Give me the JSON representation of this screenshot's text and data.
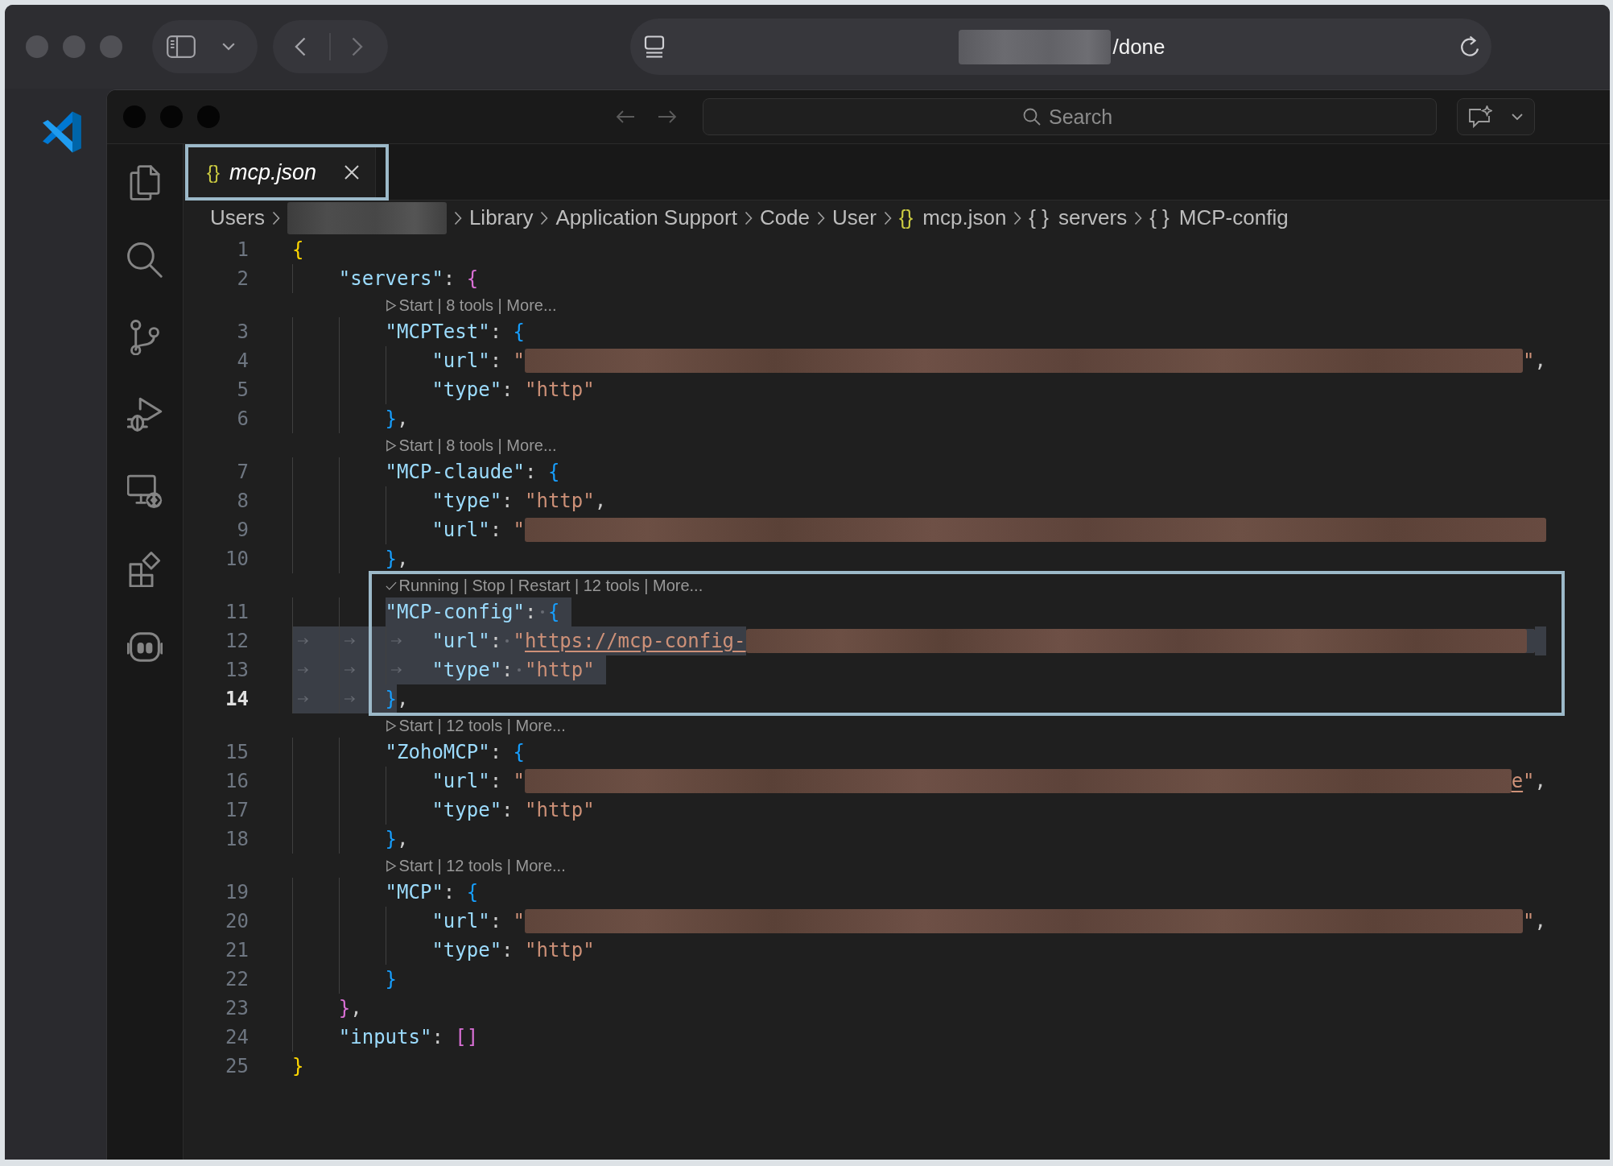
{
  "browser": {
    "address": {
      "text": "/done"
    }
  },
  "title_bar": {
    "search": {
      "placeholder": "Search"
    }
  },
  "tabs": [
    {
      "icon": "{}",
      "label": "mcp.json",
      "selected": true,
      "preview": true
    }
  ],
  "breadcrumbs": [
    {
      "kind": "text",
      "label": "Users"
    },
    {
      "kind": "redacted"
    },
    {
      "kind": "text",
      "label": "Library"
    },
    {
      "kind": "text",
      "label": "Application Support"
    },
    {
      "kind": "text",
      "label": "Code"
    },
    {
      "kind": "text",
      "label": "User"
    },
    {
      "kind": "file",
      "icon": "{}",
      "label": "mcp.json"
    },
    {
      "kind": "symbol",
      "icon": "{ }",
      "label": "servers"
    },
    {
      "kind": "symbol",
      "icon": "{ }",
      "label": "MCP-config"
    }
  ],
  "editor": {
    "lines": [
      {
        "number": "1",
        "current": false,
        "tokens": [
          {
            "kind": "bracket",
            "color": "#ffd700",
            "text": "{",
            "selected": false
          }
        ]
      },
      {
        "number": "2",
        "current": false,
        "indent_guides": [
          {
            "selected": false
          }
        ],
        "tokens": [
          {
            "kind": "key",
            "text": "\"servers\"",
            "selected": false
          },
          {
            "kind": "punct",
            "text": ": ",
            "selected": false
          },
          {
            "kind": "bracket",
            "color": "#da70d6",
            "text": "{",
            "selected": false
          }
        ]
      },
      {
        "number": "3",
        "current": false,
        "lens": {
          "running": false,
          "text": "Start | 8 tools | More..."
        },
        "indent_guides": [
          {
            "selected": false
          },
          {
            "selected": false
          }
        ],
        "tokens": [
          {
            "kind": "key",
            "text": "\"MCPTest\"",
            "selected": false
          },
          {
            "kind": "punct",
            "text": ": ",
            "selected": false
          },
          {
            "kind": "bracket",
            "color": "#179fff",
            "text": "{",
            "selected": false
          }
        ]
      },
      {
        "number": "4",
        "current": false,
        "indent_guides": [
          {
            "selected": false
          },
          {
            "selected": false
          },
          {
            "selected": false
          }
        ],
        "tokens": [
          {
            "kind": "key",
            "text": "\"url\"",
            "selected": false
          },
          {
            "kind": "punct",
            "text": ": ",
            "selected": false
          },
          {
            "kind": "string",
            "text": "\"",
            "selected": false
          },
          {
            "kind": "redacted",
            "selected": false
          },
          {
            "kind": "string",
            "text": "\"",
            "selected": false
          },
          {
            "kind": "punct",
            "text": ",",
            "selected": false
          }
        ]
      },
      {
        "number": "5",
        "current": false,
        "indent_guides": [
          {
            "selected": false
          },
          {
            "selected": false
          },
          {
            "selected": false
          }
        ],
        "tokens": [
          {
            "kind": "key",
            "text": "\"type\"",
            "selected": false
          },
          {
            "kind": "punct",
            "text": ": ",
            "selected": false
          },
          {
            "kind": "string",
            "text": "\"http\"",
            "selected": false
          }
        ]
      },
      {
        "number": "6",
        "current": false,
        "indent_guides": [
          {
            "selected": false
          },
          {
            "selected": false
          }
        ],
        "tokens": [
          {
            "kind": "bracket",
            "color": "#179fff",
            "text": "}",
            "selected": false
          },
          {
            "kind": "punct",
            "text": ",",
            "selected": false
          }
        ]
      },
      {
        "number": "7",
        "current": false,
        "lens": {
          "running": false,
          "text": "Start | 8 tools | More..."
        },
        "indent_guides": [
          {
            "selected": false
          },
          {
            "selected": false
          }
        ],
        "tokens": [
          {
            "kind": "key",
            "text": "\"MCP-claude\"",
            "selected": false
          },
          {
            "kind": "punct",
            "text": ": ",
            "selected": false
          },
          {
            "kind": "bracket",
            "color": "#179fff",
            "text": "{",
            "selected": false
          }
        ]
      },
      {
        "number": "8",
        "current": false,
        "indent_guides": [
          {
            "selected": false
          },
          {
            "selected": false
          },
          {
            "selected": false
          }
        ],
        "tokens": [
          {
            "kind": "key",
            "text": "\"type\"",
            "selected": false
          },
          {
            "kind": "punct",
            "text": ": ",
            "selected": false
          },
          {
            "kind": "string",
            "text": "\"http\"",
            "selected": false
          },
          {
            "kind": "punct",
            "text": ",",
            "selected": false
          }
        ]
      },
      {
        "number": "9",
        "current": false,
        "indent_guides": [
          {
            "selected": false
          },
          {
            "selected": false
          },
          {
            "selected": false
          }
        ],
        "tokens": [
          {
            "kind": "key",
            "text": "\"url\"",
            "selected": false
          },
          {
            "kind": "punct",
            "text": ": ",
            "selected": false
          },
          {
            "kind": "string",
            "text": "\"",
            "selected": false
          },
          {
            "kind": "redacted",
            "selected": false
          }
        ]
      },
      {
        "number": "10",
        "current": false,
        "indent_guides": [
          {
            "selected": false
          },
          {
            "selected": false
          }
        ],
        "tokens": [
          {
            "kind": "bracket",
            "color": "#179fff",
            "text": "}",
            "selected": false
          },
          {
            "kind": "punct",
            "text": ",",
            "selected": false
          }
        ]
      },
      {
        "number": "11",
        "current": false,
        "lens": {
          "running": true,
          "text": "Running | Stop | Restart | 12 tools | More..."
        },
        "indent_guides": [
          {
            "selected": false
          },
          {
            "selected": false
          }
        ],
        "tokens": [
          {
            "kind": "key",
            "text": "\"MCP-config\"",
            "selected": true
          },
          {
            "kind": "punct",
            "text": ": ",
            "selected": true
          },
          {
            "kind": "bracket",
            "color": "#179fff",
            "text": "{",
            "selected": true
          }
        ]
      },
      {
        "number": "12",
        "current": false,
        "indent_guides": [
          {
            "selected": true
          },
          {
            "selected": true
          },
          {
            "selected": true
          }
        ],
        "tokens": [
          {
            "kind": "key",
            "text": "\"url\"",
            "selected": true
          },
          {
            "kind": "punct",
            "text": ": ",
            "selected": true
          },
          {
            "kind": "string",
            "text": "\"",
            "selected": true
          },
          {
            "kind": "link",
            "text": "https://mcp-config-",
            "selected": true
          },
          {
            "kind": "redacted",
            "selected": true
          }
        ]
      },
      {
        "number": "13",
        "current": false,
        "indent_guides": [
          {
            "selected": true
          },
          {
            "selected": true
          },
          {
            "selected": true
          }
        ],
        "tokens": [
          {
            "kind": "key",
            "text": "\"type\"",
            "selected": true
          },
          {
            "kind": "punct",
            "text": ": ",
            "selected": true
          },
          {
            "kind": "string",
            "text": "\"http\"",
            "selected": true
          }
        ]
      },
      {
        "number": "14",
        "current": true,
        "indent_guides": [
          {
            "selected": true
          },
          {
            "selected": true
          }
        ],
        "tokens": [
          {
            "kind": "bracket",
            "color": "#179fff",
            "text": "}",
            "selected": true
          },
          {
            "kind": "punct",
            "text": ",",
            "selected": false
          }
        ]
      },
      {
        "number": "15",
        "current": false,
        "lens": {
          "running": false,
          "text": "Start | 12 tools | More..."
        },
        "indent_guides": [
          {
            "selected": false
          },
          {
            "selected": false
          }
        ],
        "tokens": [
          {
            "kind": "key",
            "text": "\"ZohoMCP\"",
            "selected": false
          },
          {
            "kind": "punct",
            "text": ": ",
            "selected": false
          },
          {
            "kind": "bracket",
            "color": "#179fff",
            "text": "{",
            "selected": false
          }
        ]
      },
      {
        "number": "16",
        "current": false,
        "indent_guides": [
          {
            "selected": false
          },
          {
            "selected": false
          },
          {
            "selected": false
          }
        ],
        "tokens": [
          {
            "kind": "key",
            "text": "\"url\"",
            "selected": false
          },
          {
            "kind": "punct",
            "text": ": ",
            "selected": false
          },
          {
            "kind": "string",
            "text": "\"",
            "selected": false
          },
          {
            "kind": "redacted",
            "selected": false
          },
          {
            "kind": "link",
            "text": "e",
            "selected": false
          },
          {
            "kind": "string",
            "text": "\"",
            "selected": false
          },
          {
            "kind": "punct",
            "text": ",",
            "selected": false
          }
        ]
      },
      {
        "number": "17",
        "current": false,
        "indent_guides": [
          {
            "selected": false
          },
          {
            "selected": false
          },
          {
            "selected": false
          }
        ],
        "tokens": [
          {
            "kind": "key",
            "text": "\"type\"",
            "selected": false
          },
          {
            "kind": "punct",
            "text": ": ",
            "selected": false
          },
          {
            "kind": "string",
            "text": "\"http\"",
            "selected": false
          }
        ]
      },
      {
        "number": "18",
        "current": false,
        "indent_guides": [
          {
            "selected": false
          },
          {
            "selected": false
          }
        ],
        "tokens": [
          {
            "kind": "bracket",
            "color": "#179fff",
            "text": "}",
            "selected": false
          },
          {
            "kind": "punct",
            "text": ",",
            "selected": false
          }
        ]
      },
      {
        "number": "19",
        "current": false,
        "lens": {
          "running": false,
          "text": "Start | 12 tools | More..."
        },
        "indent_guides": [
          {
            "selected": false
          },
          {
            "selected": false
          }
        ],
        "tokens": [
          {
            "kind": "key",
            "text": "\"MCP\"",
            "selected": false
          },
          {
            "kind": "punct",
            "text": ": ",
            "selected": false
          },
          {
            "kind": "bracket",
            "color": "#179fff",
            "text": "{",
            "selected": false
          }
        ]
      },
      {
        "number": "20",
        "current": false,
        "indent_guides": [
          {
            "selected": false
          },
          {
            "selected": false
          },
          {
            "selected": false
          }
        ],
        "tokens": [
          {
            "kind": "key",
            "text": "\"url\"",
            "selected": false
          },
          {
            "kind": "punct",
            "text": ": ",
            "selected": false
          },
          {
            "kind": "string",
            "text": "\"",
            "selected": false
          },
          {
            "kind": "redacted",
            "selected": false
          },
          {
            "kind": "string",
            "text": "\"",
            "selected": false
          },
          {
            "kind": "punct",
            "text": ",",
            "selected": false
          }
        ]
      },
      {
        "number": "21",
        "current": false,
        "indent_guides": [
          {
            "selected": false
          },
          {
            "selected": false
          },
          {
            "selected": false
          }
        ],
        "tokens": [
          {
            "kind": "key",
            "text": "\"type\"",
            "selected": false
          },
          {
            "kind": "punct",
            "text": ": ",
            "selected": false
          },
          {
            "kind": "string",
            "text": "\"http\"",
            "selected": false
          }
        ]
      },
      {
        "number": "22",
        "current": false,
        "indent_guides": [
          {
            "selected": false
          },
          {
            "selected": false
          }
        ],
        "tokens": [
          {
            "kind": "bracket",
            "color": "#179fff",
            "text": "}",
            "selected": false
          }
        ]
      },
      {
        "number": "23",
        "current": false,
        "indent_guides": [
          {
            "selected": false
          }
        ],
        "tokens": [
          {
            "kind": "bracket",
            "color": "#da70d6",
            "text": "}",
            "selected": false
          },
          {
            "kind": "punct",
            "text": ",",
            "selected": false
          }
        ]
      },
      {
        "number": "24",
        "current": false,
        "indent_guides": [
          {
            "selected": false
          }
        ],
        "tokens": [
          {
            "kind": "key",
            "text": "\"inputs\"",
            "selected": false
          },
          {
            "kind": "punct",
            "text": ": ",
            "selected": false
          },
          {
            "kind": "bracket",
            "color": "#da70d6",
            "text": "[]",
            "selected": false
          }
        ]
      },
      {
        "number": "25",
        "current": false,
        "tokens": [
          {
            "kind": "bracket",
            "color": "#ffd700",
            "text": "}",
            "selected": false
          }
        ]
      }
    ]
  }
}
